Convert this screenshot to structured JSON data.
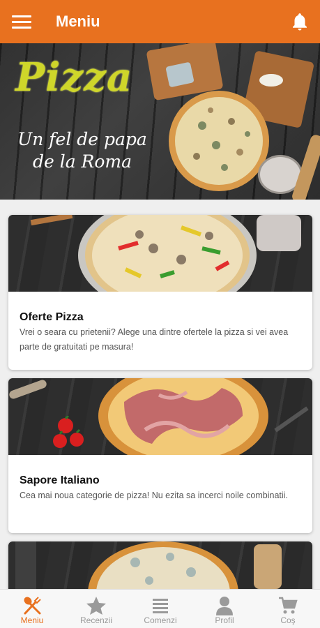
{
  "app_bar": {
    "title": "Meniu",
    "color": "#e8711f",
    "left_icon": "menu-icon",
    "right_icon": "bell-icon"
  },
  "hero": {
    "title": "Pizza",
    "subtitle_line1": "Un fel de papa",
    "subtitle_line2": "de la Roma"
  },
  "cards": [
    {
      "title": "Oferte Pizza",
      "description": "Vrei o seara cu prietenii? Alege una dintre ofertele la pizza si vei avea parte de gratuitati pe masura!"
    },
    {
      "title": "Sapore Italiano",
      "description": "Cea mai noua categorie de pizza! Nu ezita sa incerci noile combinatii."
    },
    {
      "title": "",
      "description": ""
    }
  ],
  "bottom_nav": {
    "active_color": "#e8711f",
    "inactive_color": "#9a9a9a",
    "items": [
      {
        "label": "Meniu",
        "icon": "fork-spoon-icon",
        "active": true
      },
      {
        "label": "Recenzii",
        "icon": "star-icon",
        "active": false
      },
      {
        "label": "Comenzi",
        "icon": "list-icon",
        "active": false
      },
      {
        "label": "Profil",
        "icon": "person-icon",
        "active": false
      },
      {
        "label": "Coş",
        "icon": "cart-icon",
        "active": false
      }
    ]
  }
}
